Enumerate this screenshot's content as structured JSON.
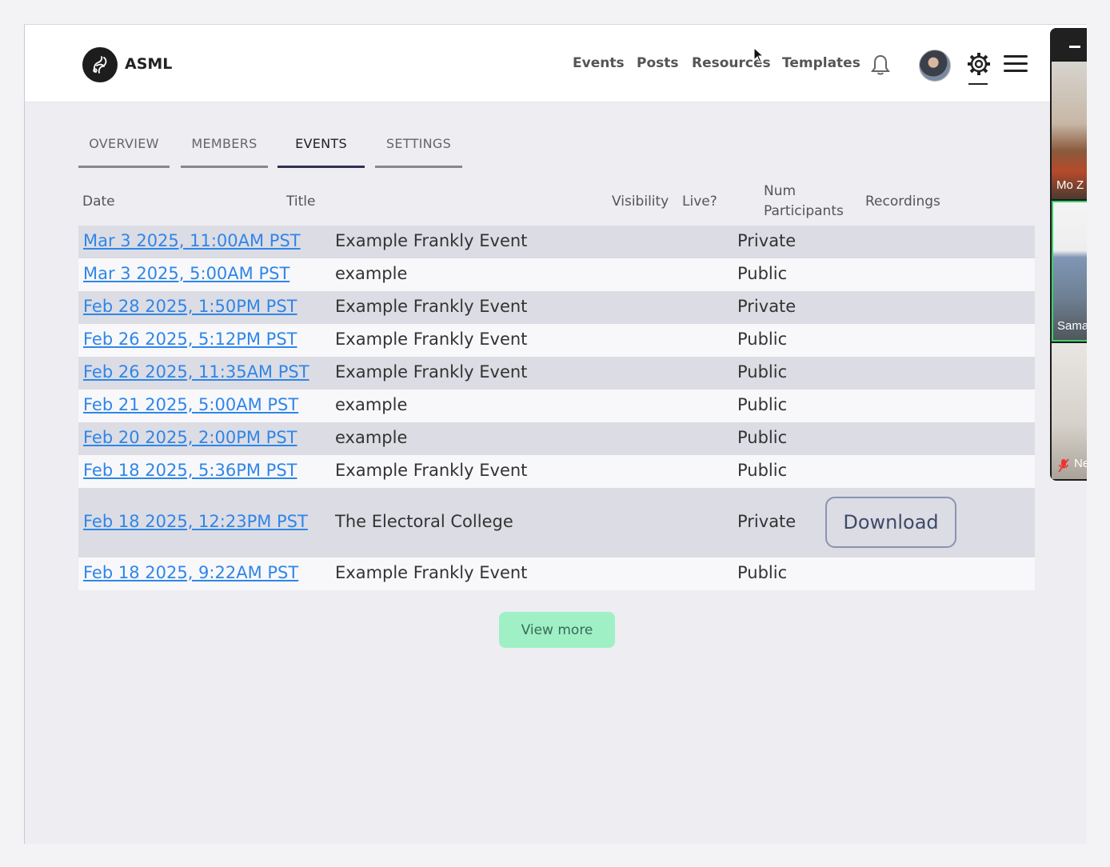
{
  "header": {
    "brand": "ASML",
    "nav": [
      "Events",
      "Posts",
      "Resources",
      "Templates"
    ]
  },
  "tabs": [
    {
      "label": "OVERVIEW",
      "active": false
    },
    {
      "label": "MEMBERS",
      "active": false
    },
    {
      "label": "EVENTS",
      "active": true
    },
    {
      "label": "SETTINGS",
      "active": false
    }
  ],
  "table": {
    "headers": {
      "date": "Date",
      "title": "Title",
      "visibility": "Visibility",
      "live": "Live?",
      "num_participants_1": "Num",
      "num_participants_2": "Participants",
      "recordings": "Recordings"
    },
    "rows": [
      {
        "date": "Mar 3 2025, 11:00AM PST",
        "title": "Example Frankly Event",
        "visibility": "Private"
      },
      {
        "date": "Mar 3 2025, 5:00AM PST",
        "title": "example",
        "visibility": "Public"
      },
      {
        "date": "Feb 28 2025, 1:50PM PST",
        "title": "Example Frankly Event",
        "visibility": "Private"
      },
      {
        "date": "Feb 26 2025, 5:12PM PST",
        "title": "Example Frankly Event",
        "visibility": "Public"
      },
      {
        "date": "Feb 26 2025, 11:35AM PST",
        "title": "Example Frankly Event",
        "visibility": "Public"
      },
      {
        "date": "Feb 21 2025, 5:00AM PST",
        "title": "example",
        "visibility": "Public"
      },
      {
        "date": "Feb 20 2025, 2:00PM PST",
        "title": "example",
        "visibility": "Public"
      },
      {
        "date": "Feb 18 2025, 5:36PM PST",
        "title": "Example Frankly Event",
        "visibility": "Public"
      },
      {
        "date": "Feb 18 2025, 12:23PM PST",
        "title": "The Electoral College",
        "visibility": "Private",
        "recording": "Download"
      },
      {
        "date": "Feb 18 2025, 9:22AM PST",
        "title": "Example Frankly Event",
        "visibility": "Public"
      }
    ]
  },
  "view_more_label": "View more",
  "video_panel": {
    "tiles": [
      "Mo Z",
      "Sama",
      "Ne"
    ]
  },
  "colors": {
    "link": "#2f86e8",
    "active_tab": "#2f2f55",
    "view_more_bg": "#9ff0c5",
    "row_shade": "#dcdce4"
  },
  "icons": [
    "logo-icon",
    "bell-icon",
    "avatar",
    "gear-icon",
    "hamburger-menu-icon",
    "muted-mic-icon",
    "cursor-icon"
  ]
}
